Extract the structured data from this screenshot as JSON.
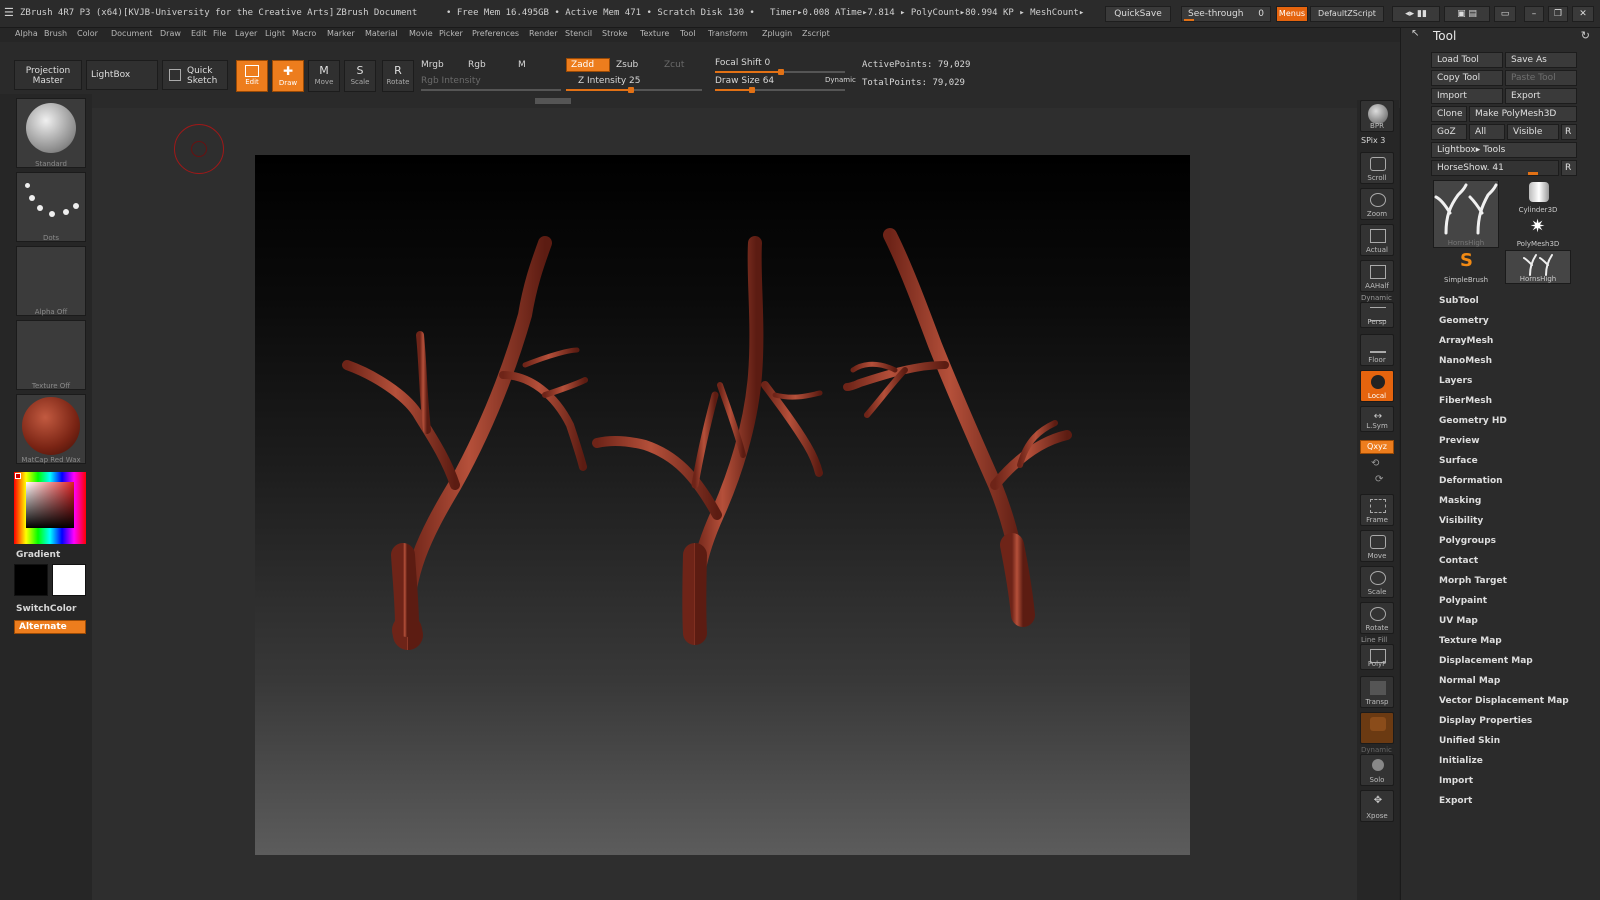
{
  "titlebar": {
    "app": "ZBrush 4R7 P3 (x64)[KVJB-University for the Creative Arts]",
    "document": "ZBrush Document",
    "stats": "• Free Mem 16.495GB • Active Mem 471 • Scratch Disk 130 •",
    "timer": "Timer▸0.008 ATime▸7.814 ▸ PolyCount▸80.994 KP ▸ MeshCount▸",
    "quicksave": "QuickSave",
    "seethrough": "See-through",
    "seethrough_value": "0",
    "menus": "Menus",
    "script": "DefaultZScript"
  },
  "menubar": [
    "Alpha",
    "Brush",
    "Color",
    "Document",
    "Draw",
    "Edit",
    "File",
    "Layer",
    "Light",
    "Macro",
    "Marker",
    "Material",
    "Movie",
    "Picker",
    "Preferences",
    "Render",
    "Stencil",
    "Stroke",
    "Texture",
    "Tool",
    "Transform",
    "Zplugin",
    "Zscript"
  ],
  "shelf": {
    "projection_master": "Projection Master",
    "lightbox": "LightBox",
    "quick_sketch": "Quick Sketch",
    "edit": "Edit",
    "draw": "Draw",
    "move": "Move",
    "scale": "Scale",
    "rotate": "Rotate",
    "mrgb": "Mrgb",
    "rgb": "Rgb",
    "m": "M",
    "rgb_intensity": "Rgb Intensity",
    "zadd": "Zadd",
    "zsub": "Zsub",
    "zcut": "Zcut",
    "z_intensity": "Z Intensity 25",
    "z_intensity_value": 25,
    "focal_shift": "Focal Shift 0",
    "draw_size": "Draw Size 64",
    "draw_size_value": 64,
    "dynamic": "Dynamic",
    "active_points": "ActivePoints: 79,029",
    "total_points": "TotalPoints: 79,029"
  },
  "lefttray": {
    "brush": "Standard",
    "stroke": "Dots",
    "alpha": "Alpha Off",
    "texture": "Texture Off",
    "material": "MatCap Red Wax",
    "gradient": "Gradient",
    "switchcolor": "SwitchColor",
    "alternate": "Alternate"
  },
  "rstrip": {
    "bpr": "BPR",
    "spix": "SPix 3",
    "scroll": "Scroll",
    "zoom": "Zoom",
    "actual": "Actual",
    "aahalf": "AAHalf",
    "dynamic": "Dynamic",
    "persp": "Persp",
    "floor": "Floor",
    "local": "Local",
    "lsym": "L.Sym",
    "xyz": "Qxyz",
    "frame": "Frame",
    "move": "Move",
    "scale": "Scale",
    "rotate": "Rotate",
    "linefill": "Line Fill",
    "polyf": "PolyF",
    "transp": "Transp",
    "ghost": "Ghost",
    "dynamic2": "Dynamic",
    "solo": "Solo",
    "xpose": "Xpose"
  },
  "palette": {
    "title": "Tool",
    "load_tool": "Load Tool",
    "save_as": "Save As",
    "copy_tool": "Copy Tool",
    "paste_tool": "Paste Tool",
    "import": "Import",
    "export": "Export",
    "clone": "Clone",
    "make_polymesh": "Make PolyMesh3D",
    "goz": "GoZ",
    "all": "All",
    "visible": "Visible",
    "r": "R",
    "lightbox_tools": "Lightbox▸ Tools",
    "current_tool": "HorseShow. 41",
    "meshes": [
      "HornsHigh",
      "Cylinder3D",
      "PolyMesh3D",
      "SimpleBrush",
      "HornsHigh"
    ],
    "sections": [
      "SubTool",
      "Geometry",
      "ArrayMesh",
      "NanoMesh",
      "Layers",
      "FiberMesh",
      "Geometry HD",
      "Preview",
      "Surface",
      "Deformation",
      "Masking",
      "Visibility",
      "Polygroups",
      "Contact",
      "Morph Target",
      "Polypaint",
      "UV Map",
      "Texture Map",
      "Displacement Map",
      "Normal Map",
      "Vector Displacement Map",
      "Display Properties",
      "Unified Skin",
      "Initialize",
      "Import",
      "Export"
    ]
  }
}
